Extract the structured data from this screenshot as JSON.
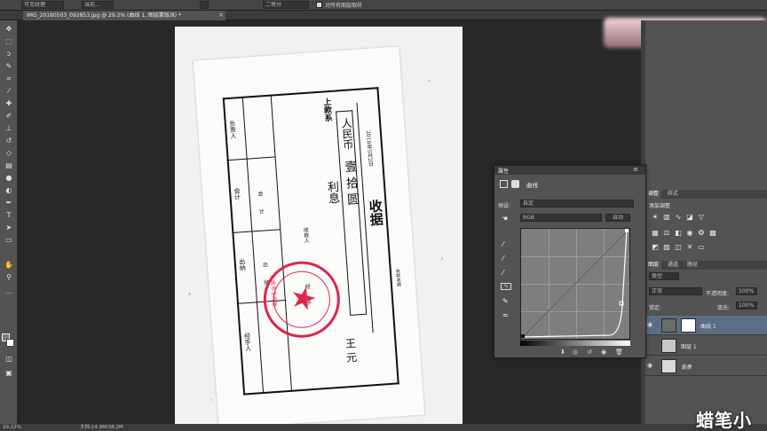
{
  "options_bar": {
    "preset_value": "可见纹理",
    "layer_option": "当前...",
    "channel_value": "二等分",
    "sample_label": "对所有图层取样"
  },
  "document_tab": {
    "title": "IMG_20180503_092853.jpg @ 29.2% (曲线 1, 图层蒙版/8) *",
    "close": "×"
  },
  "status_bar": {
    "zoom": "29.22%",
    "doc_info": "文档:14.9M/38.2M"
  },
  "receipt": {
    "payer_label": "上款系",
    "currency": "人民币",
    "amount_handwritten": "壹 拾 圆",
    "note_handwritten": "利息",
    "title_handwritten": "收据",
    "date": "2018年5月2日",
    "side_label": "收款收据",
    "row_labels": [
      "负责人",
      "会计",
      "出纳",
      "经手人"
    ],
    "mid_labels": [
      "会",
      "计",
      "出",
      "纳",
      "收款人",
      "经",
      "手"
    ],
    "stamp_text": "人民币专用章",
    "signature": "王 元"
  },
  "properties_panel": {
    "title": "属性",
    "panel_name": "曲线",
    "preset_label": "预设:",
    "preset_value": "自定",
    "channel_value": "RGB",
    "auto_button": "自动",
    "footer_icons": [
      "clip-icon",
      "eye-preview-icon",
      "reset-icon",
      "visibility-icon",
      "trash-icon"
    ]
  },
  "right_panels": {
    "adjust_tabs": [
      "调整",
      "样式"
    ],
    "adjust_title": "添加调整",
    "layers_tabs": [
      "图层",
      "通道",
      "路径"
    ],
    "kind_filter": "类型",
    "blend_mode": "正常",
    "opacity_label": "不透明度:",
    "opacity_value": "100%",
    "lock_label": "锁定:",
    "fill_label": "填充:",
    "fill_value": "100%",
    "layers": [
      {
        "name": "曲线 1",
        "selected": true
      },
      {
        "name": "图层 1",
        "selected": false
      },
      {
        "name": "背景",
        "selected": false
      }
    ]
  },
  "watermark": "蜡笔小",
  "colors": {
    "stamp_red": "#e0254a",
    "selected_layer": "#5b6e86",
    "panel_bg": "#535353"
  }
}
